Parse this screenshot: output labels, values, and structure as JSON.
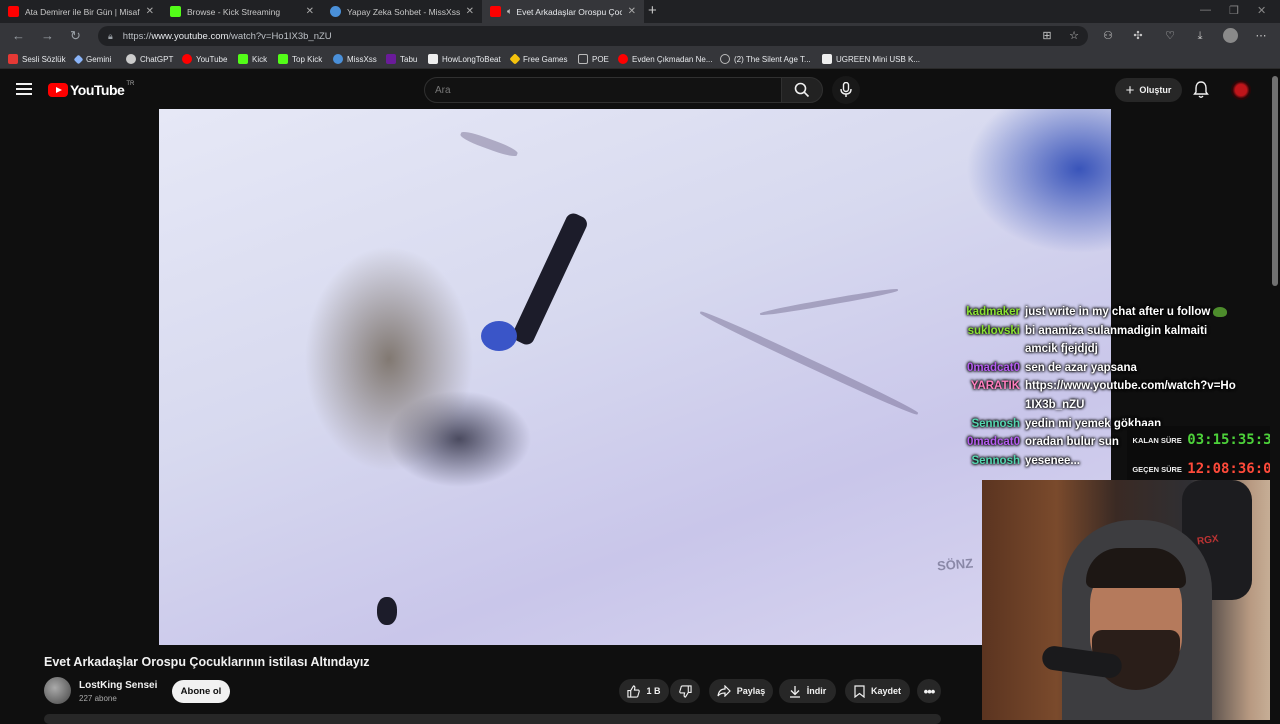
{
  "browser": {
    "tabs": [
      {
        "title": "Ata Demirer ile Bir Gün | Misafirin",
        "favicon_color": "#ff0000",
        "active": false
      },
      {
        "title": "Browse - Kick Streaming",
        "favicon_color": "#53fc18",
        "active": false
      },
      {
        "title": "Yapay Zeka Sohbet - MissXss AI F",
        "favicon_color": "#4a90d9",
        "active": false
      },
      {
        "title": "Evet Arkadaşlar Orospu Çocu",
        "favicon_color": "#ff0000",
        "active": true
      }
    ],
    "new_tab_label": "+",
    "address": {
      "prefix": "https://",
      "domain": "www.youtube.com",
      "path": "/watch?v=Ho1IX3b_nZU"
    },
    "bookmarks": [
      {
        "label": "Sesli Sözlük",
        "color": "#e53935"
      },
      {
        "label": "Gemini",
        "color": "#8ab4f8"
      },
      {
        "label": "ChatGPT",
        "color": "#cccccc"
      },
      {
        "label": "YouTube",
        "color": "#ff0000"
      },
      {
        "label": "Kick",
        "color": "#53fc18"
      },
      {
        "label": "Top Kick",
        "color": "#53fc18"
      },
      {
        "label": "MissXss",
        "color": "#4a90d9"
      },
      {
        "label": "Tabu",
        "color": "#6a1b9a"
      },
      {
        "label": "HowLongToBeat",
        "color": "#eeeeee"
      },
      {
        "label": "Free Games",
        "color": "#f4c20d"
      },
      {
        "label": "POE",
        "color": "#9e9e9e"
      },
      {
        "label": "Evden Çıkmadan Ne...",
        "color": "#ff0000"
      },
      {
        "label": "(2) The Silent Age T...",
        "color": "#9e9e9e"
      },
      {
        "label": "UGREEN Mini USB K...",
        "color": "#eeeeee"
      }
    ]
  },
  "youtube": {
    "logo_text": "YouTube",
    "country_code": "TR",
    "search_placeholder": "Ara",
    "create_label": "Oluştur",
    "video_overlay_text": "SÖNZ"
  },
  "chat": [
    {
      "user": "kadmaker",
      "color": "#8ae234",
      "message": "just write in my chat after u follow",
      "emote": true
    },
    {
      "user": "suklovski",
      "color": "#8ae234",
      "message": "bi anamiza sulanmadigin kalmaiti amcik fjejdjdj",
      "emote": false
    },
    {
      "user": "0madcat0",
      "color": "#b55cf0",
      "message": "sen de azar yapsana",
      "emote": false
    },
    {
      "user": "YARATIK",
      "color": "#ff7fbf",
      "message": "https://www.youtube.com/watch?v=Ho1IX3b_nZU",
      "emote": false
    },
    {
      "user": "Sennosh",
      "color": "#55d6b0",
      "message": "yedin mi yemek gökhaan",
      "emote": false
    },
    {
      "user": "0madcat0",
      "color": "#b55cf0",
      "message": "oradan bulur sun",
      "emote": false
    },
    {
      "user": "Sennosh",
      "color": "#55d6b0",
      "message": "yesenee...",
      "emote": false
    }
  ],
  "timer": {
    "remaining_label": "KALAN SÜRE",
    "remaining_value": "03:15:35:33",
    "remaining_color": "#4dd23a",
    "elapsed_label": "GEÇEN SÜRE",
    "elapsed_value": "12:08:36:04",
    "elapsed_color": "#ff4a3a"
  },
  "video": {
    "title": "Evet Arkadaşlar Orospu Çocuklarının istilası Altındayız",
    "channel_name": "LostKing Sensei",
    "subscribers": "227 abone",
    "subscribe_label": "Abone ol",
    "like_count": "1 B",
    "share_label": "Paylaş",
    "download_label": "İndir",
    "save_label": "Kaydet"
  }
}
